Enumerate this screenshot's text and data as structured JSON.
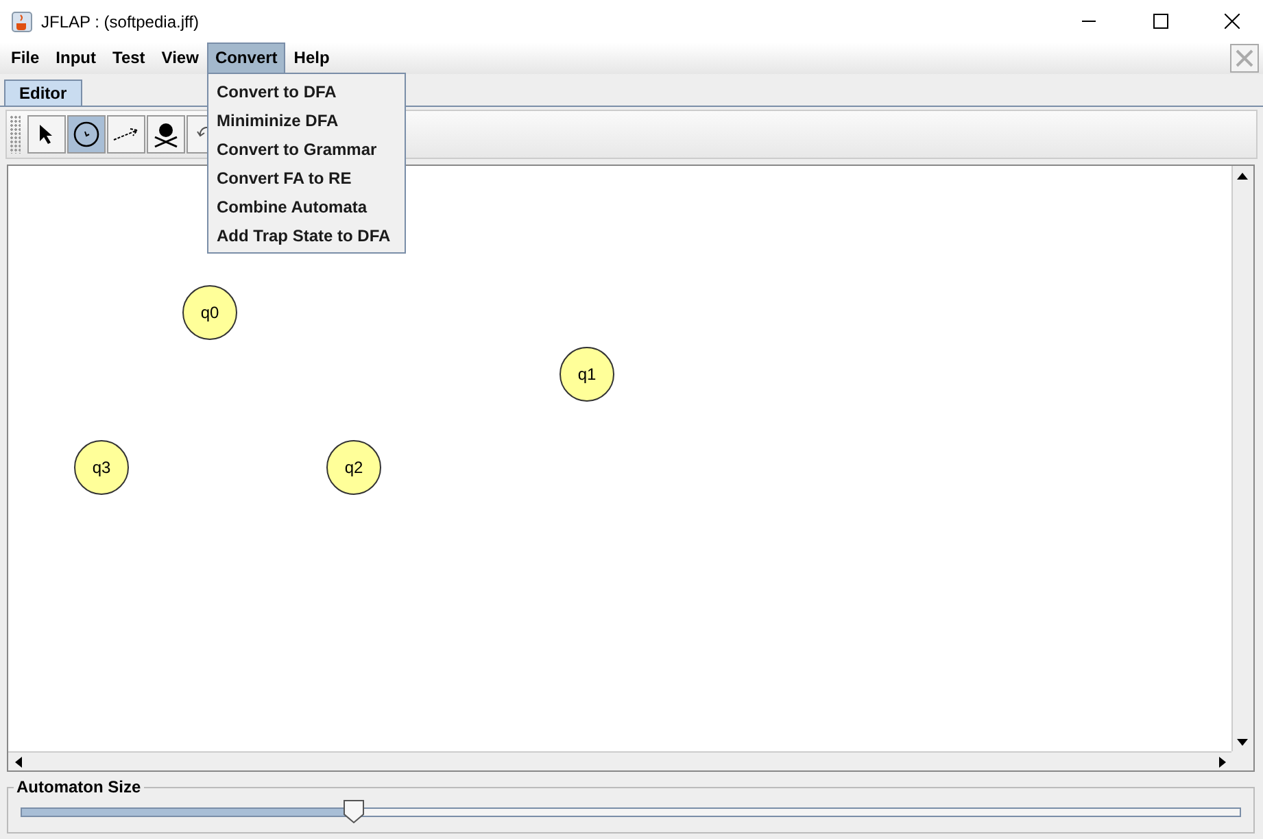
{
  "window": {
    "title": "JFLAP : (softpedia.jff)"
  },
  "menu_bar": [
    {
      "label": "File",
      "selected": false
    },
    {
      "label": "Input",
      "selected": false
    },
    {
      "label": "Test",
      "selected": false
    },
    {
      "label": "View",
      "selected": false
    },
    {
      "label": "Convert",
      "selected": true
    },
    {
      "label": "Help",
      "selected": false
    }
  ],
  "dropdown": [
    "Convert to DFA",
    "Miniminize DFA",
    "Convert to Grammar",
    "Convert FA to RE",
    "Combine Automata",
    "Add Trap State to DFA"
  ],
  "tabs": [
    {
      "label": "Editor",
      "selected": true
    }
  ],
  "tools": [
    {
      "kind": "select",
      "selected": false
    },
    {
      "kind": "state",
      "selected": true
    },
    {
      "kind": "transition",
      "selected": false
    },
    {
      "kind": "delete",
      "selected": false
    },
    {
      "kind": "undo",
      "selected": false
    }
  ],
  "states": [
    {
      "label": "q0"
    },
    {
      "label": "q1"
    },
    {
      "label": "q3"
    },
    {
      "label": "q2"
    }
  ],
  "automaton_size": {
    "label": "Automaton Size",
    "level": 0.274
  }
}
